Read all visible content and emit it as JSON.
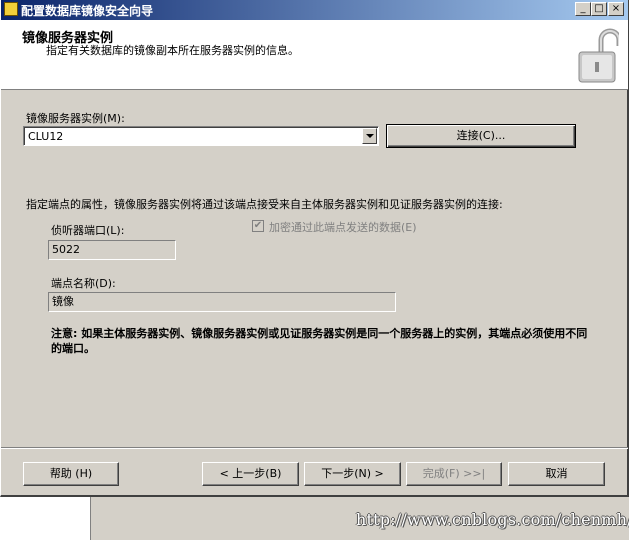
{
  "window": {
    "title": "配置数据库镜像安全向导",
    "controls": {
      "minimize": "_",
      "maximize": "□",
      "close": "×"
    }
  },
  "header": {
    "title": "镜像服务器实例",
    "subtitle": "指定有关数据库的镜像副本所在服务器实例的信息。",
    "icon": "padlock-open-icon"
  },
  "mirror_instance": {
    "label": "镜像服务器实例(M):",
    "selected_value": "CLU12",
    "connect_button": "连接(C)..."
  },
  "endpoint": {
    "description": "指定端点的属性，镜像服务器实例将通过该端点接受来自主体服务器实例和见证服务器实例的连接:",
    "port_label": "侦听器端口(L):",
    "port_value": "5022",
    "encrypt_label": "加密通过此端点发送的数据(E)",
    "encrypt_checked": true,
    "name_label": "端点名称(D):",
    "name_value": "镜像"
  },
  "note": "注意: 如果主体服务器实例、镜像服务器实例或见证服务器实例是同一个服务器上的实例，其端点必须使用不同的端口。",
  "footer": {
    "help": "帮助 (H)",
    "back": "< 上一步(B)",
    "next": "下一步(N) >",
    "finish": "完成(F) >>|",
    "cancel": "取消"
  },
  "watermark": "http://www.cnblogs.com/chenmh/"
}
